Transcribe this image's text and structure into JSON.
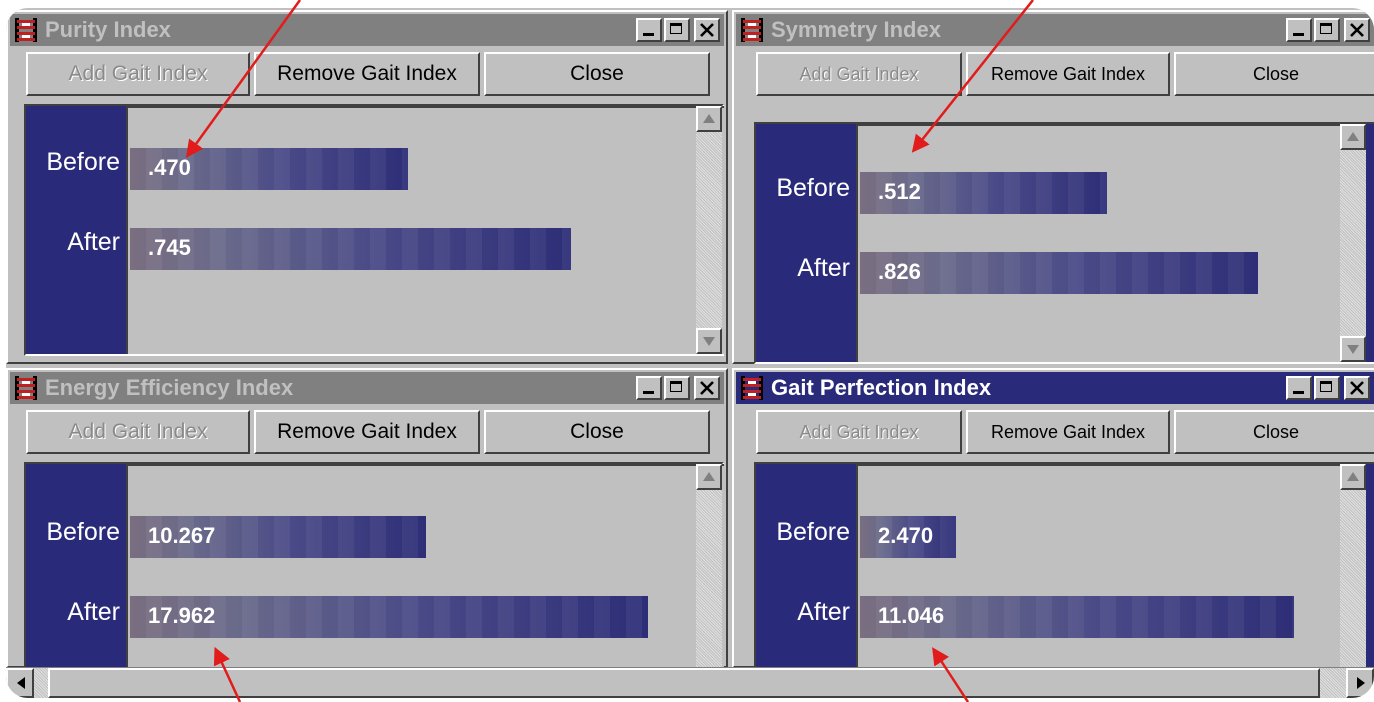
{
  "colors": {
    "active_title": "#2a2a7a",
    "inactive_title": "#808080",
    "bar_dark": "#2e2e78",
    "bar_light": "#7a6e80",
    "annotation_arrow": "#e21b1b",
    "window_face": "#c0c0c0"
  },
  "icons": {
    "app": "gait-app-icon",
    "minimize": "minimize-icon",
    "maximize": "maximize-icon",
    "close": "close-icon",
    "scroll_up": "scroll-up-arrow-icon",
    "scroll_down": "scroll-down-arrow-icon",
    "scroll_left": "scroll-left-arrow-icon",
    "scroll_right": "scroll-right-arrow-icon"
  },
  "windows": [
    {
      "title": "Purity Index",
      "active": false,
      "buttons": {
        "add": "Add Gait Index",
        "remove": "Remove Gait Index",
        "close": "Close"
      },
      "add_disabled": true,
      "rows": [
        {
          "label": "Before",
          "value": ".470",
          "fill": 0.47
        },
        {
          "label": "After",
          "value": ".745",
          "fill": 0.745
        }
      ]
    },
    {
      "title": "Symmetry Index",
      "active": false,
      "buttons": {
        "add": "Add Gait Index",
        "remove": "Remove Gait Index",
        "close": "Close"
      },
      "add_disabled": true,
      "rows": [
        {
          "label": "Before",
          "value": ".512",
          "fill": 0.512
        },
        {
          "label": "After",
          "value": ".826",
          "fill": 0.826
        }
      ]
    },
    {
      "title": "Energy Efficiency Index",
      "active": false,
      "buttons": {
        "add": "Add Gait Index",
        "remove": "Remove Gait Index",
        "close": "Close"
      },
      "add_disabled": true,
      "rows": [
        {
          "label": "Before",
          "value": "10.267",
          "fill": 0.5
        },
        {
          "label": "After",
          "value": "17.962",
          "fill": 0.875
        }
      ]
    },
    {
      "title": "Gait Perfection Index",
      "active": true,
      "buttons": {
        "add": "Add Gait Index",
        "remove": "Remove Gait Index",
        "close": "Close"
      },
      "add_disabled": true,
      "rows": [
        {
          "label": "Before",
          "value": "2.470",
          "fill": 0.2
        },
        {
          "label": "After",
          "value": "11.046",
          "fill": 0.9
        }
      ]
    }
  ]
}
